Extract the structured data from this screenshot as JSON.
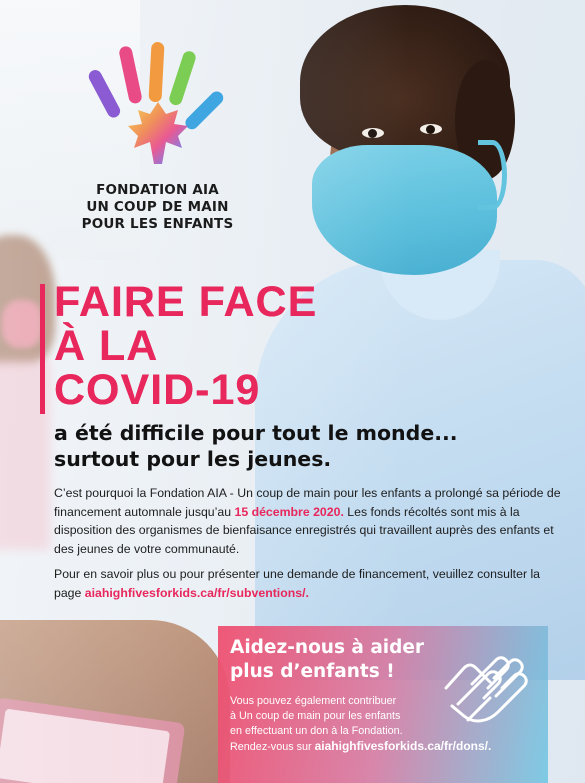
{
  "logo": {
    "org_line1": "FONDATION AIA",
    "org_line2": "UN COUP DE MAIN",
    "org_line3": "POUR LES ENFANTS",
    "icon": "rainbow-hand-maple-leaf-icon"
  },
  "headline": {
    "line1": "FAIRE FACE",
    "line2": "À LA",
    "line3": "COVID-19",
    "color": "#e8275c"
  },
  "subhead": {
    "line1": "a été difficile pour tout le monde...",
    "line2": "surtout pour les jeunes."
  },
  "body": {
    "p1_part1": "C’est pourquoi la Fondation AIA - Un coup de main pour les enfants a prolongé sa période de financement automnale jusqu’au ",
    "p1_date": "15 décembre 2020.",
    "p1_part2": " Les fonds récoltés sont mis à la disposition des organismes de bienfaisance enregistrés qui travaillent auprès des enfants et des jeunes de votre communauté.",
    "p2_part1": "Pour en savoir plus ou pour présenter une demande de financement, veuillez consulter la page ",
    "p2_link": "aiahighfivesforkids.ca/fr/subventions/."
  },
  "panel": {
    "title_line1": "Aidez-nous à aider",
    "title_line2": "plus d’enfants !",
    "text_line1": "Vous pouvez également contribuer",
    "text_line2": "à Un coup de main pour les enfants",
    "text_line3": "en effectuant un don à la Fondation.",
    "text_line4_prefix": "Rendez-vous sur ",
    "text_line4_link": "aiahighfivesforkids.ca/fr/dons/.",
    "icon": "handshake-icon"
  }
}
